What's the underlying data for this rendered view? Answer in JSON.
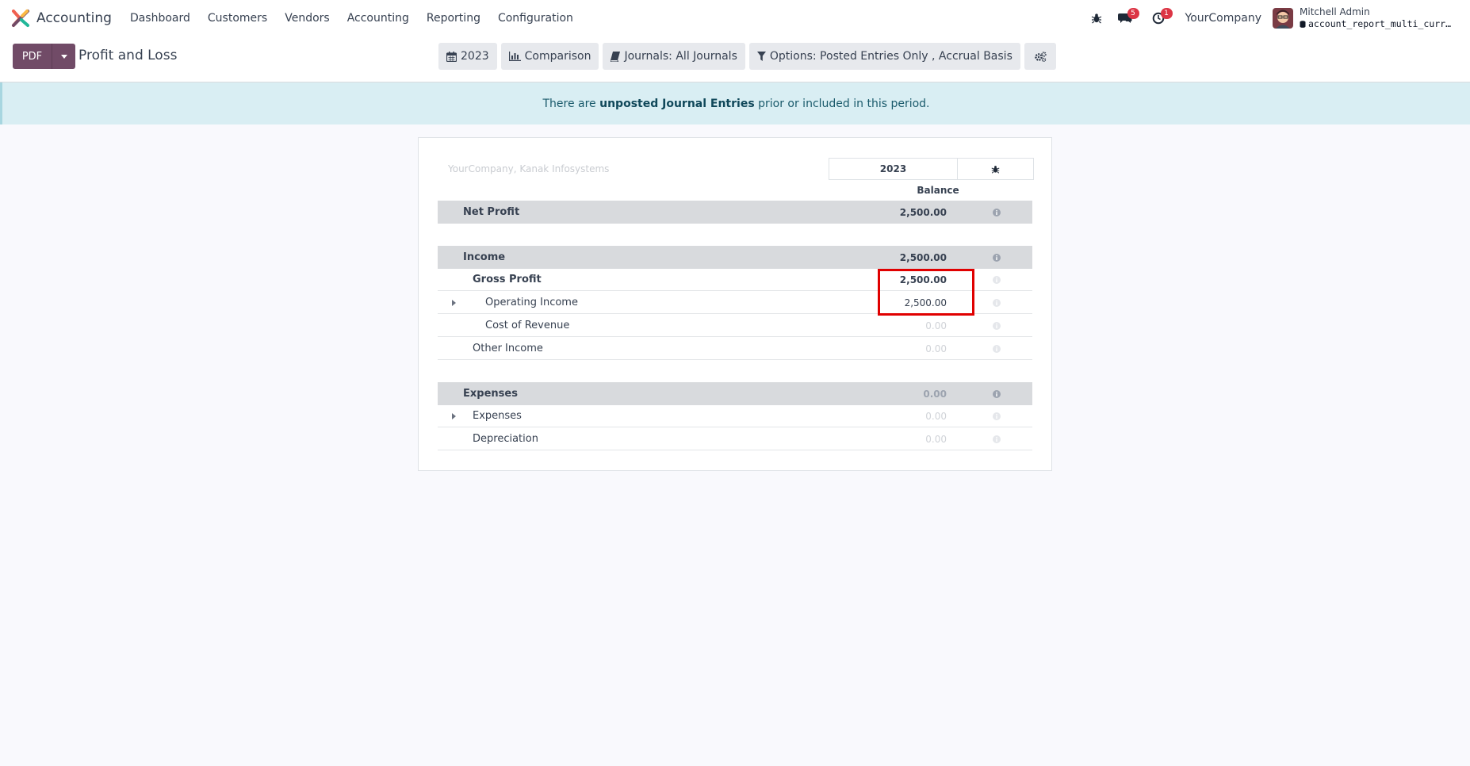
{
  "navbar": {
    "app_name": "Accounting",
    "menu": [
      "Dashboard",
      "Customers",
      "Vendors",
      "Accounting",
      "Reporting",
      "Configuration"
    ],
    "messages_count": "5",
    "activities_count": "1",
    "company": "YourCompany",
    "user_name": "Mitchell Admin",
    "database": "account_report_multi_currency"
  },
  "control": {
    "pdf_label": "PDF",
    "title": "Profit and Loss",
    "filters": {
      "period": "2023",
      "comparison": "Comparison",
      "journals": "Journals: All Journals",
      "options": "Options: Posted Entries Only , Accrual Basis"
    }
  },
  "alert": {
    "prefix": "There are ",
    "link": "unposted Journal Entries",
    "suffix": " prior or included in this period."
  },
  "report": {
    "company_line": "YourCompany, Kanak Infosystems",
    "column_period": "2023",
    "column_label": "Balance",
    "rows": [
      {
        "label": "Net Profit",
        "value": "2,500.00"
      },
      {
        "label": "Income",
        "value": "2,500.00"
      },
      {
        "label": "Gross Profit",
        "value": "2,500.00"
      },
      {
        "label": "Operating Income",
        "value": "2,500.00"
      },
      {
        "label": "Cost of Revenue",
        "value": "0.00"
      },
      {
        "label": "Other Income",
        "value": "0.00"
      },
      {
        "label": "Expenses",
        "value": "0.00"
      },
      {
        "label": "Expenses",
        "value": "0.00"
      },
      {
        "label": "Depreciation",
        "value": "0.00"
      }
    ]
  },
  "colors": {
    "brand": "#714b67",
    "section_bg": "#d8dadd",
    "alert_bg": "#d9eef3",
    "highlight": "#e00000"
  }
}
